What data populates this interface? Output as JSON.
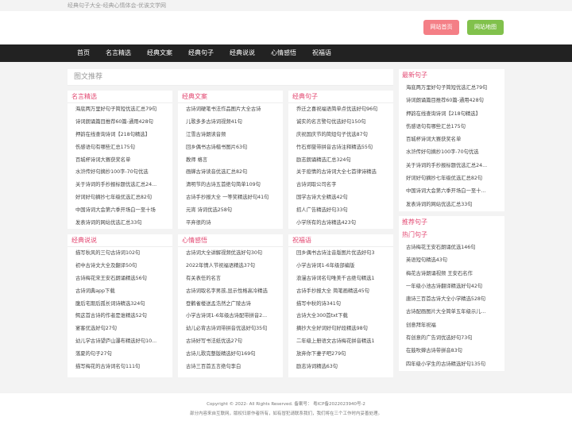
{
  "topbar": {
    "text": "经典句子大全-经典心情体会-优诶文学网"
  },
  "header": {
    "home_label": "网站首页",
    "map_label": "网站地图"
  },
  "nav": [
    "首页",
    "名言精选",
    "经典文案",
    "经典句子",
    "经典说说",
    "心情感悟",
    "祝福语"
  ],
  "left_title": "图文推荐",
  "columns": [
    {
      "title": "名言精选",
      "items": [
        "海底两万里好句子简短优选汇总79句",
        "诗词朗诵篇目推荐60篇-通用428句",
        "押韵在线查询诗词【218句精选】",
        "伤感语句有哪些汇总175句",
        "百城杯诗词大赛获奖名单",
        "水浒传好句摘抄100字-70句优选",
        "关于诗词的手抄报标题优选汇总24...",
        "好词好句摘抄七年级优选汇总82句",
        "中国诗词大会第六季开场白一至十场",
        "发表诗词的网站优选汇总33句"
      ]
    },
    {
      "title": "经典文案",
      "items": [
        "古诗词硬笔书法作品图片大全古诗",
        "儿歌多多古诗词视频41句",
        "江雪古诗朗读音频",
        "回乡偶书古诗楷书图片63句",
        "教师 格言",
        "画蝉古诗读音优选汇总82句",
        "清明节的古诗五首绝句简单109句",
        "古诗手抄报大全 一等奖精选好句41句",
        "元宵 诗词优选258句",
        "平弃很的诗"
      ]
    },
    {
      "title": "经典句子",
      "items": [
        "乔迁之喜祝福语简单点优选好句96句",
        "诚实的名言警句优选好句150句",
        "庆祝国庆节的简短句子优选87句",
        "竹石郑燮带拼音古诗注释精选55句",
        "励志朗诵精选汇总324句",
        "关于疫情的古诗词大全七首律诗精选",
        "古诗词取公司名字",
        "国学古诗大全精选42句",
        "招人广告精选好句33句",
        "小学所有的古诗精选423句"
      ]
    },
    {
      "title": "经典说说",
      "items": [
        "描写秋风的三句古诗词102句",
        "初中古诗文大全及翻译50句",
        "古诗梅花宋王安石朗诵精选56句",
        "古诗词典app下载",
        "腹后宅期后孤长词诗精选324句",
        "鳄这首古诗的作者是谁精选52句",
        "宴客优选好句27句",
        "幼儿学古诗望庐山瀑布精选好句10...",
        "落夏的句子27句",
        "描写梅花的古诗词名句111句"
      ]
    },
    {
      "title": "心情感悟",
      "items": [
        "古诗词大全讲解视频优选好句30句",
        "2022年情人节祝福语精选37句",
        "有关表任的名言",
        "古诗词取名字男孩,显示性格高冷精选",
        "登鹳雀楼送孟浩然之广陵古诗",
        "小学古诗词1-6年级古诗配带拼音2...",
        "幼儿必背古诗词带拼音优选好句35句",
        "古诗好写书法纸优选27句",
        "古诗儿歌完整版精选好句169句",
        "古诗三百首五言绝句李白"
      ]
    },
    {
      "title": "祝福语",
      "items": [
        "回乡偶书古诗注音版图片优选好句3",
        "小学古诗词1-6年级部编版",
        "浪漫古诗词名句唯美千古绝句精选1",
        "古诗手抄报大全 简笔画精选45句",
        "描写中秋的诗341句",
        "古诗大全300首txt下载",
        "摘抄大全好词好句好段精选98句",
        "二年级上册语文古诗梅花拼音精选1",
        "放弃你下妻子吧279句",
        "励志诗词精选63句"
      ]
    }
  ],
  "right_boxes": [
    {
      "title": "最新句子",
      "items": [
        "海底两万里好句子简短优选汇总79句",
        "诗词朗诵篇目推荐60篇-通用428句",
        "押韵在线查询诗词【218句精选】",
        "伤感语句有哪些汇总175句",
        "百城杯诗词大赛获奖名单",
        "水浒传好句摘抄100字-70句优选",
        "关于诗词的手抄报标题优选汇总24...",
        "好词好句摘抄七年级优选汇总82句",
        "中国诗词大会第六季开场白一至十...",
        "发表诗词的网站优选汇总33句"
      ]
    },
    {
      "title": "推荐句子",
      "items": []
    },
    {
      "title": "热门句子",
      "items": [
        "古诗梅花王安石朗诵优选146句",
        "英语短句精选43句",
        "梅花古诗朗诵视频 王安石名作",
        "一年级小池古诗翻译精选好句42句",
        "唐诗三百首古诗大全小学精选528句",
        "古诗配画图片大全简单五年级示儿...",
        "创意拜年祝福",
        "有创意的广告词优选好句73句",
        "在鼓吹蝉古诗带拼音83句",
        "四年级小学生的古诗精选好句135句"
      ]
    }
  ],
  "footer": {
    "line1": "Copyright © 2022- All Rights Reserved. 备案号： 粤ICP备2022023940号-2",
    "line2": "部分内容来自互联网，版权归原作者所有，如有冒犯请联系我们，我们将在三个工作时内妥善处理。"
  }
}
